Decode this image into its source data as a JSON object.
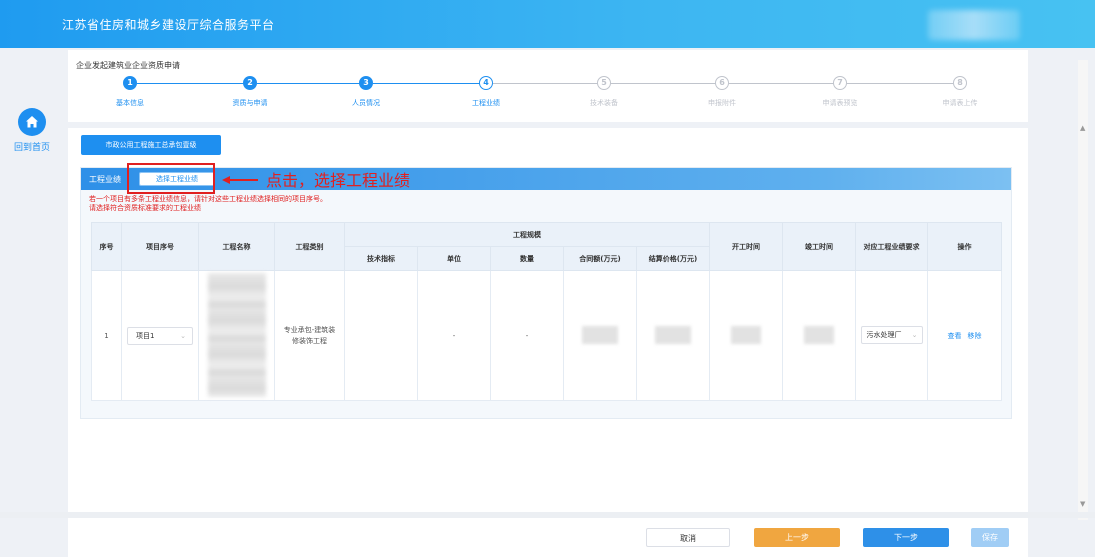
{
  "header": {
    "title": "江苏省住房和城乡建设厅综合服务平台"
  },
  "nav": {
    "home_label": "回到首页"
  },
  "breadcrumb": "企业发起建筑业企业资质申请",
  "steps": [
    {
      "num": "1",
      "label": "基本信息",
      "state": "done"
    },
    {
      "num": "2",
      "label": "资质与申请",
      "state": "done"
    },
    {
      "num": "3",
      "label": "人员情况",
      "state": "done"
    },
    {
      "num": "4",
      "label": "工程业绩",
      "state": "current"
    },
    {
      "num": "5",
      "label": "技术装备",
      "state": "todo"
    },
    {
      "num": "6",
      "label": "申报附件",
      "state": "todo"
    },
    {
      "num": "7",
      "label": "申请表预览",
      "state": "todo"
    },
    {
      "num": "8",
      "label": "申请表上传",
      "state": "todo"
    }
  ],
  "qual_tab": "市政公用工程施工总承包壹级",
  "panel": {
    "title": "工程业绩",
    "select_button": "选择工程业绩",
    "note1": "若一个项目有多条工程业绩信息，请针对这些工程业绩选择相同的项目序号。",
    "note2": "请选择符合资质标准要求的工程业绩"
  },
  "annotation": "点击，选择工程业绩",
  "table": {
    "headers": {
      "seq": "序号",
      "project_no": "项目序号",
      "name": "工程名称",
      "type": "工程类别",
      "scale": "工程规模",
      "tech_index": "技术指标",
      "unit": "单位",
      "qty": "数量",
      "contract": "合同额(万元)",
      "settlement": "结算价格(万元)",
      "start": "开工时间",
      "finish": "竣工时间",
      "requirement": "对应工程业绩要求",
      "ops": "操作"
    },
    "rows": [
      {
        "seq": "1",
        "project_no": "项目1",
        "type": "专业承包-建筑装修装饰工程",
        "unit": "-",
        "qty": "-",
        "requirement": "污水处理厂",
        "view": "查看",
        "remove": "移除"
      }
    ]
  },
  "footer": {
    "cancel": "取消",
    "prev": "上一步",
    "next": "下一步",
    "save": "保存"
  },
  "colors": {
    "primary": "#1e8ff0",
    "warning": "#f0a640",
    "annotation": "#e02020"
  }
}
